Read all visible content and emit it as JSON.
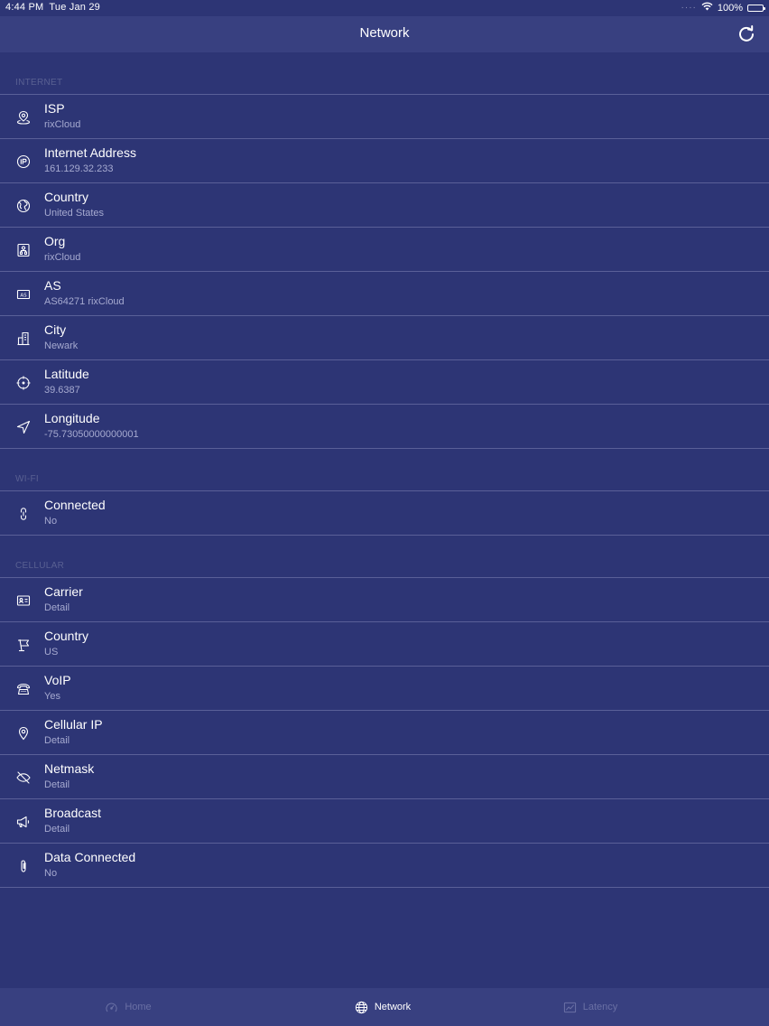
{
  "status_bar": {
    "time": "4:44 PM",
    "date": "Tue Jan 29",
    "battery": "100%"
  },
  "nav": {
    "title": "Network"
  },
  "sections": {
    "internet": {
      "header": "INTERNET",
      "rows": [
        {
          "label": "ISP",
          "value": "rixCloud",
          "icon": "map-pin-icon"
        },
        {
          "label": "Internet Address",
          "value": "161.129.32.233",
          "icon": "ip-icon"
        },
        {
          "label": "Country",
          "value": "United States",
          "icon": "globe-icon"
        },
        {
          "label": "Org",
          "value": "rixCloud",
          "icon": "org-icon"
        },
        {
          "label": "AS",
          "value": "AS64271 rixCloud",
          "icon": "as-icon"
        },
        {
          "label": "City",
          "value": "Newark",
          "icon": "building-icon"
        },
        {
          "label": "Latitude",
          "value": "39.6387",
          "icon": "crosshair-icon"
        },
        {
          "label": "Longitude",
          "value": "-75.73050000000001",
          "icon": "navigation-icon"
        }
      ]
    },
    "wifi": {
      "header": "WI-FI",
      "rows": [
        {
          "label": "Connected",
          "value": "No",
          "icon": "link-icon"
        }
      ]
    },
    "cellular": {
      "header": "CELLULAR",
      "rows": [
        {
          "label": "Carrier",
          "value": "Detail",
          "icon": "id-card-icon"
        },
        {
          "label": "Country",
          "value": "US",
          "icon": "flag-icon"
        },
        {
          "label": "VoIP",
          "value": "Yes",
          "icon": "phone-icon"
        },
        {
          "label": "Cellular IP",
          "value": "Detail",
          "icon": "location-pin-icon"
        },
        {
          "label": "Netmask",
          "value": "Detail",
          "icon": "eye-off-icon"
        },
        {
          "label": "Broadcast",
          "value": "Detail",
          "icon": "megaphone-icon"
        },
        {
          "label": "Data Connected",
          "value": "No",
          "icon": "paperclip-icon"
        }
      ]
    }
  },
  "tabs": [
    {
      "label": "Home",
      "icon": "speedometer-icon",
      "active": false
    },
    {
      "label": "Network",
      "icon": "globe-icon",
      "active": true
    },
    {
      "label": "Latency",
      "icon": "chart-icon",
      "active": false
    }
  ],
  "colors": {
    "background": "#2d3575",
    "bar": "#384080",
    "divider": "#5a6098",
    "section_header": "#596092",
    "secondary_text": "#a6aad0",
    "inactive_tab": "#6a70a4"
  }
}
